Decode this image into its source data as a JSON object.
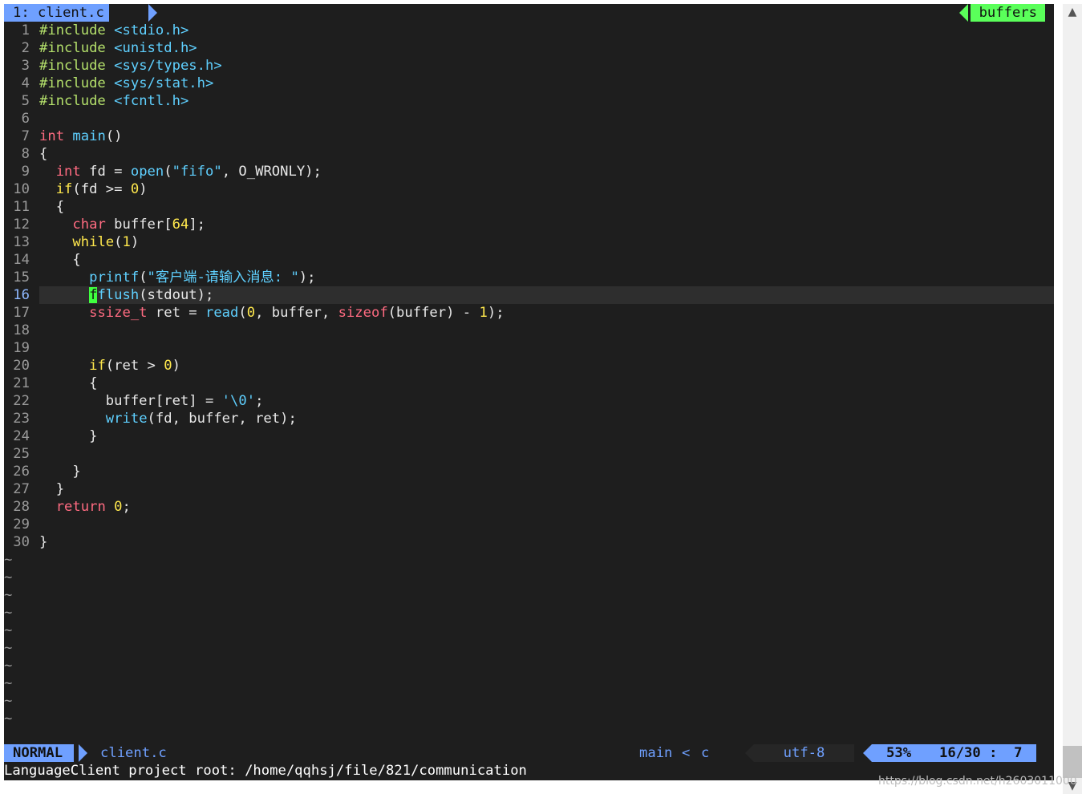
{
  "tabline": {
    "active_tab": "1: client.c",
    "buffers_label": "buffers"
  },
  "colors": {
    "accent_blue": "#6fa0ff",
    "accent_green": "#5aff5a",
    "background": "#1e1e1e"
  },
  "code_lines": [
    {
      "n": "1",
      "text": "#include <stdio.h>"
    },
    {
      "n": "2",
      "text": "#include <unistd.h>"
    },
    {
      "n": "3",
      "text": "#include <sys/types.h>"
    },
    {
      "n": "4",
      "text": "#include <sys/stat.h>"
    },
    {
      "n": "5",
      "text": "#include <fcntl.h>"
    },
    {
      "n": "6",
      "text": ""
    },
    {
      "n": "7",
      "text": "int main()"
    },
    {
      "n": "8",
      "text": "{"
    },
    {
      "n": "9",
      "text": "  int fd = open(\"fifo\", O_WRONLY);"
    },
    {
      "n": "10",
      "text": "  if(fd >= 0)"
    },
    {
      "n": "11",
      "text": "  {"
    },
    {
      "n": "12",
      "text": "    char buffer[64];"
    },
    {
      "n": "13",
      "text": "    while(1)"
    },
    {
      "n": "14",
      "text": "    {"
    },
    {
      "n": "15",
      "text": "      printf(\"客户端-请输入消息: \");"
    },
    {
      "n": "16",
      "text": "      fflush(stdout);"
    },
    {
      "n": "17",
      "text": "      ssize_t ret = read(0, buffer, sizeof(buffer) - 1);"
    },
    {
      "n": "18",
      "text": ""
    },
    {
      "n": "19",
      "text": ""
    },
    {
      "n": "20",
      "text": "      if(ret > 0)"
    },
    {
      "n": "21",
      "text": "      {"
    },
    {
      "n": "22",
      "text": "        buffer[ret] = '\\0';"
    },
    {
      "n": "23",
      "text": "        write(fd, buffer, ret);"
    },
    {
      "n": "24",
      "text": "      }"
    },
    {
      "n": "25",
      "text": ""
    },
    {
      "n": "26",
      "text": "    }"
    },
    {
      "n": "27",
      "text": "  }"
    },
    {
      "n": "28",
      "text": "  return 0;"
    },
    {
      "n": "29",
      "text": ""
    },
    {
      "n": "30",
      "text": "}"
    }
  ],
  "tilde_char": "~",
  "statusline": {
    "mode": "NORMAL",
    "filename": "client.c",
    "function": "main",
    "separator": "<",
    "filetype": "c",
    "encoding": "utf-8",
    "percent": "53%",
    "line_pos": "16/30 :  7"
  },
  "cmdline": "LanguageClient project root: /home/qqhsj/file/821/communication",
  "watermark": "https://blog.csdn.net/h2603011000"
}
